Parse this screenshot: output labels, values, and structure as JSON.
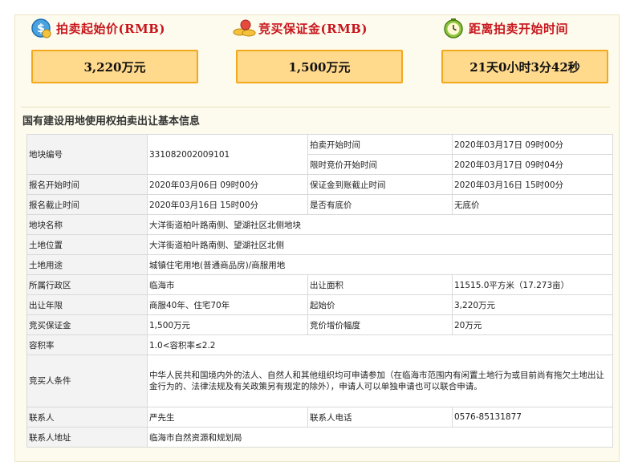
{
  "stats": [
    {
      "icon": "price-tag-icon",
      "title": "拍卖起始价(RMB)",
      "value": "3,220万元"
    },
    {
      "icon": "coins-icon",
      "title": "竞买保证金(RMB)",
      "value": "1,500万元"
    },
    {
      "icon": "clock-icon",
      "title": "距离拍卖开始时间",
      "value": "21天0小时3分42秒"
    }
  ],
  "section_title": "国有建设用地使用权拍卖出让基本信息",
  "table": {
    "plot_no_label": "地块编号",
    "plot_no": "331082002009101",
    "auction_start_label": "拍卖开始时间",
    "auction_start": "2020年03月17日 09时00分",
    "limited_start_label": "限时竞价开始时间",
    "limited_start": "2020年03月17日 09时04分",
    "reg_start_label": "报名开始时间",
    "reg_start": "2020年03月06日 09时00分",
    "deposit_deadline_label": "保证金到账截止时间",
    "deposit_deadline": "2020年03月16日 15时00分",
    "reg_end_label": "报名截止时间",
    "reg_end": "2020年03月16日 15时00分",
    "reserve_label": "是否有底价",
    "reserve": "无底价",
    "plot_name_label": "地块名称",
    "plot_name": "大洋街道柏叶路南侧、望湖社区北侧地块",
    "location_label": "土地位置",
    "location": "大洋街道柏叶路南侧、望湖社区北侧",
    "usage_label": "土地用途",
    "usage": "城镇住宅用地(普通商品房)/商服用地",
    "district_label": "所属行政区",
    "district": "临海市",
    "area_label": "出让面积",
    "area": "11515.0平方米（17.273亩）",
    "term_label": "出让年限",
    "term": "商服40年、住宅70年",
    "start_price_label": "起始价",
    "start_price": "3,220万元",
    "deposit_label": "竞买保证金",
    "deposit": "1,500万元",
    "increment_label": "竞价增价幅度",
    "increment": "20万元",
    "far_label": "容积率",
    "far": "1.0<容积率≤2.2",
    "conditions_label": "竞买人条件",
    "conditions": "中华人民共和国境内外的法人、自然人和其他组织均可申请参加（在临海市范围内有闲置土地行为或目前尚有拖欠土地出让金行为的、法律法规及有关政策另有规定的除外），申请人可以单独申请也可以联合申请。",
    "contact_label": "联系人",
    "contact": "严先生",
    "phone_label": "联系人电话",
    "phone": "0576-85131877",
    "address_label": "联系人地址",
    "address": "临海市自然资源和规划局"
  },
  "colors": {
    "accent": "#c8161d",
    "box_fill": "#ffd98c",
    "box_border": "#f3a81e",
    "panel": "#fdfbee"
  }
}
